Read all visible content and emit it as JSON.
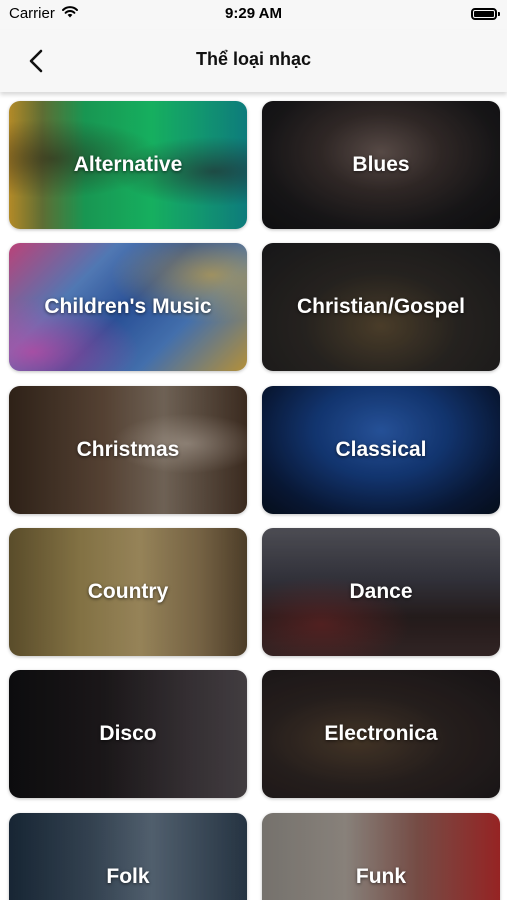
{
  "status_bar": {
    "carrier": "Carrier",
    "time": "9:29 AM"
  },
  "nav": {
    "title": "Thể loại nhạc"
  },
  "genres": [
    {
      "label": "Alternative"
    },
    {
      "label": "Blues"
    },
    {
      "label": "Children's Music"
    },
    {
      "label": "Christian/Gospel"
    },
    {
      "label": "Christmas"
    },
    {
      "label": "Classical"
    },
    {
      "label": "Country"
    },
    {
      "label": "Dance"
    },
    {
      "label": "Disco"
    },
    {
      "label": "Electronica"
    },
    {
      "label": "Folk"
    },
    {
      "label": "Funk"
    }
  ]
}
